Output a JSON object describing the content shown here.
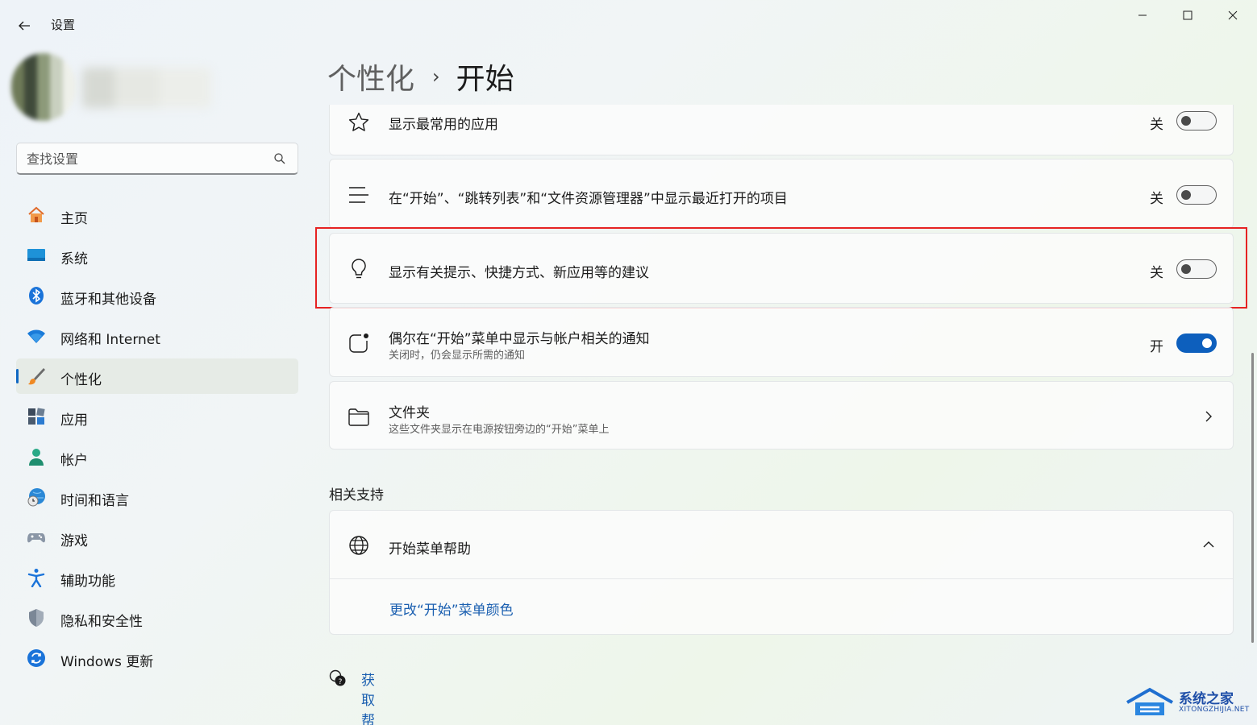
{
  "window": {
    "title": "设置"
  },
  "search": {
    "placeholder": "查找设置"
  },
  "nav": {
    "items": [
      {
        "label": "主页",
        "icon": "home-icon"
      },
      {
        "label": "系统",
        "icon": "system-icon"
      },
      {
        "label": "蓝牙和其他设备",
        "icon": "bluetooth-icon"
      },
      {
        "label": "网络和 Internet",
        "icon": "wifi-icon"
      },
      {
        "label": "个性化",
        "icon": "brush-icon",
        "active": true
      },
      {
        "label": "应用",
        "icon": "apps-icon"
      },
      {
        "label": "帐户",
        "icon": "account-icon"
      },
      {
        "label": "时间和语言",
        "icon": "time-language-icon"
      },
      {
        "label": "游戏",
        "icon": "gamepad-icon"
      },
      {
        "label": "辅助功能",
        "icon": "accessibility-icon"
      },
      {
        "label": "隐私和安全性",
        "icon": "shield-icon"
      },
      {
        "label": "Windows 更新",
        "icon": "update-icon"
      }
    ]
  },
  "header": {
    "parent": "个性化",
    "separator": "›",
    "current": "开始"
  },
  "settings": [
    {
      "title": "显示最常用的应用",
      "state": "关",
      "on": false,
      "icon": "star-icon"
    },
    {
      "title": "在“开始”、“跳转列表”和“文件资源管理器”中显示最近打开的项目",
      "state": "关",
      "on": false,
      "icon": "list-icon"
    },
    {
      "title": "显示有关提示、快捷方式、新应用等的建议",
      "state": "关",
      "on": false,
      "icon": "lightbulb-icon",
      "highlighted": true
    },
    {
      "title": "偶尔在“开始”菜单中显示与帐户相关的通知",
      "subtitle": "关闭时，仍会显示所需的通知",
      "state": "开",
      "on": true,
      "icon": "notification-icon"
    },
    {
      "title": "文件夹",
      "subtitle": "这些文件夹显示在电源按钮旁边的“开始”菜单上",
      "icon": "folder-icon"
    }
  ],
  "related": {
    "title": "相关支持",
    "help_title": "开始菜单帮助",
    "link": "更改“开始”菜单颜色"
  },
  "get_help": "获取帮助",
  "watermark": {
    "title": "系统之家",
    "subtitle": "XITONGZHIJIA.NET"
  },
  "colors": {
    "accent": "#0d5fbd",
    "highlight_border": "#e62222",
    "link": "#1a5fb0"
  }
}
